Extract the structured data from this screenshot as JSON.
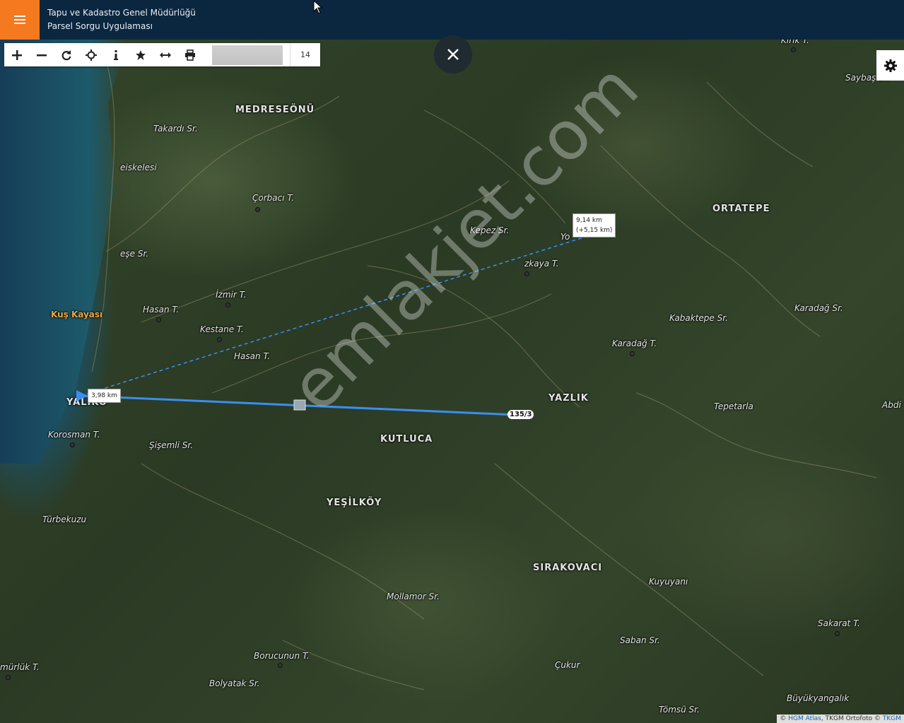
{
  "header": {
    "title_line1": "Tapu ve Kadastro Genel Müdürlüğü",
    "title_line2": "Parsel Sorgu Uygulaması",
    "menu_icon": "hamburger-menu-icon",
    "accent_color": "#f4791f",
    "bg_color": "#0b2740"
  },
  "toolbar": {
    "tools": [
      "zoom-in-icon",
      "zoom-out-icon",
      "refresh-icon",
      "locate-icon",
      "info-icon",
      "favorite-icon",
      "measure-icon",
      "print-icon"
    ],
    "search_value": "",
    "zoom_level": "14"
  },
  "map": {
    "labels": {
      "medreseonu": "MEDRESEÖNÜ",
      "takardi": "Takardı Sr.",
      "eiskelesi": "eiskelesi",
      "corbaci": "Çorbacı T.",
      "kepez": "Kepez Sr.",
      "yo": "Yo",
      "ortatepe": "ORTATEPE",
      "saybay": "Saybaş Sr.",
      "kirik": "Kırık T.",
      "ese": "eşe Sr.",
      "kaya": "zkaya T.",
      "izmir": "İzmir T.",
      "kuskayasi": "Kuş Kayası",
      "hasan1": "Hasan T.",
      "kestane": "Kestane T.",
      "hasan2": "Hasan T.",
      "kabaktepe": "Kabaktepe Sr.",
      "karadag_sr": "Karadağ Sr.",
      "karadag_t": "Karadağ T.",
      "yazlik": "YAZLIK",
      "tepetarla": "Tepetarla",
      "abdi": "Abdi",
      "yalikoy": "YALIKÖ",
      "korosman": "Korosman T.",
      "sisemli": "Şişemli Sr.",
      "kutluca": "KUTLUCA",
      "yesilkoy": "YEŞİLKÖY",
      "turbekuzu": "Türbekuzu",
      "sirakovaci": "SIRAKOVACI",
      "kuyuyani": "Kuyuyanı",
      "mollamor": "Mollamor Sr.",
      "sakarat": "Sakarat T.",
      "saban": "Saban Sr.",
      "borucunun": "Borucunun T.",
      "cukur": "Çukur",
      "murluk": "mürlük T.",
      "bolyatak": "Bolyatak Sr.",
      "buyukyangalik": "Büyükyangalık",
      "tomsu": "Tömsü Sr."
    },
    "measure": {
      "segment_label": "3,98 km",
      "total_label_line1": "9,14 km",
      "total_label_line2": "(+5,15 km)",
      "line_color": "#3a8ef0"
    },
    "parcel_label": "135/3",
    "watermark": "emlakjet.com",
    "attribution": {
      "prefix": "©",
      "hgm": "HGM Atlas",
      "middle": ", TKGM Ortofoto ©",
      "tkgm": "TKGM"
    }
  }
}
